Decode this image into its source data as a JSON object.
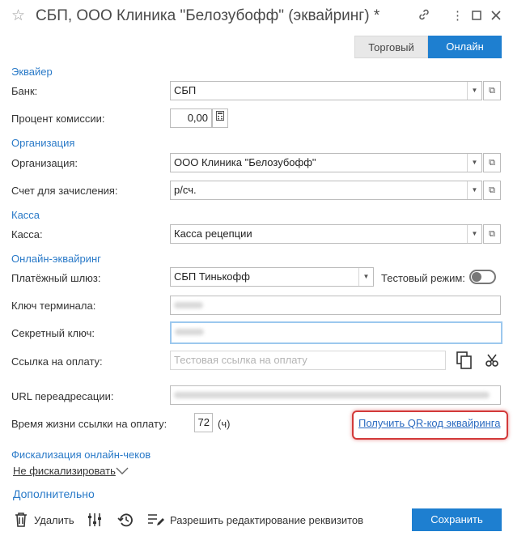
{
  "window": {
    "title": "СБП, ООО Клиника \"Белозубофф\" (эквайринг) *",
    "icons": [
      "star-icon",
      "link-icon",
      "more-vert-icon",
      "maximize-icon",
      "close-icon"
    ]
  },
  "mode_tabs": [
    {
      "label": "Торговый",
      "active": false
    },
    {
      "label": "Онлайн",
      "active": true
    }
  ],
  "sections": {
    "acquirer": "Эквайер",
    "organization": "Организация",
    "cashbox": "Касса",
    "online_acquiring": "Онлайн-эквайринг",
    "fiscalization": "Фискализация онлайн-чеков",
    "additional": "Дополнительно"
  },
  "fields": {
    "bank": {
      "label": "Банк:",
      "value": "СБП"
    },
    "commission": {
      "label": "Процент комиссии:",
      "value": "0,00"
    },
    "organization": {
      "label": "Организация:",
      "value": "ООО Клиника \"Белозубофф\""
    },
    "account": {
      "label": "Счет для зачисления:",
      "value": "р/сч."
    },
    "cashbox": {
      "label": "Касса:",
      "value": "Касса рецепции"
    },
    "gateway": {
      "label": "Платёжный шлюз:",
      "value": "СБП Тинькофф"
    },
    "test_mode": {
      "label": "Тестовый режим:",
      "on": false
    },
    "terminal_key": {
      "label": "Ключ терминала:"
    },
    "secret_key": {
      "label": "Секретный ключ:"
    },
    "payment_link": {
      "label": "Ссылка на оплату:",
      "placeholder": "Тестовая ссылка на оплату"
    },
    "redirect_url": {
      "label": "URL переадресации:"
    },
    "link_lifetime": {
      "label": "Время жизни ссылки на оплату:",
      "value": "72",
      "unit": "(ч)"
    }
  },
  "qr_link": "Получить QR-код эквайринга",
  "fiscalization_option": "Не фискализировать",
  "toolbar": {
    "delete": "Удалить",
    "allow_edit": "Разрешить редактирование реквизитов",
    "save": "Сохранить"
  },
  "colors": {
    "accent": "#1e7fd0",
    "section": "#2a7ac8",
    "highlight": "#d33a3a"
  }
}
